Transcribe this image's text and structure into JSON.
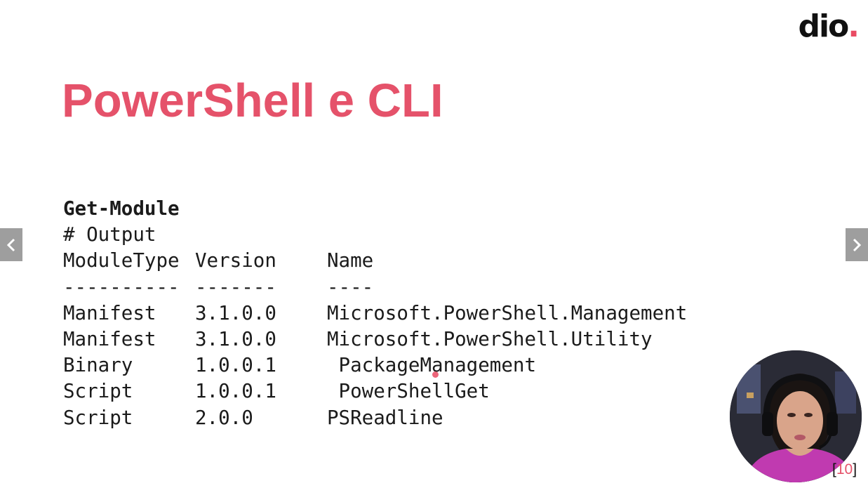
{
  "brand": {
    "text": "dio",
    "dot": "."
  },
  "slide": {
    "title": "PowerShell e CLI",
    "command": "Get-Module",
    "comment": "# Output",
    "table": {
      "headers": [
        "ModuleType",
        "Version",
        "Name"
      ],
      "separators": [
        "----------",
        "-------",
        "----"
      ],
      "rows": [
        [
          "Manifest",
          "3.1.0.0",
          "Microsoft.PowerShell.Management"
        ],
        [
          "Manifest",
          "3.1.0.0",
          "Microsoft.PowerShell.Utility"
        ],
        [
          "Binary",
          "1.0.0.1",
          " PackageManagement"
        ],
        [
          "Script",
          "1.0.0.1",
          " PowerShellGet"
        ],
        [
          "Script",
          "2.0.0",
          "PSReadline"
        ]
      ]
    },
    "page_open": "[",
    "page_number": "10",
    "page_close": "]"
  },
  "navigation": {
    "prev_icon": "chevron-left-icon",
    "next_icon": "chevron-right-icon"
  },
  "colors": {
    "accent": "#e5526a",
    "text": "#1b1b1b",
    "nav_bg": "#9e9e9e"
  }
}
